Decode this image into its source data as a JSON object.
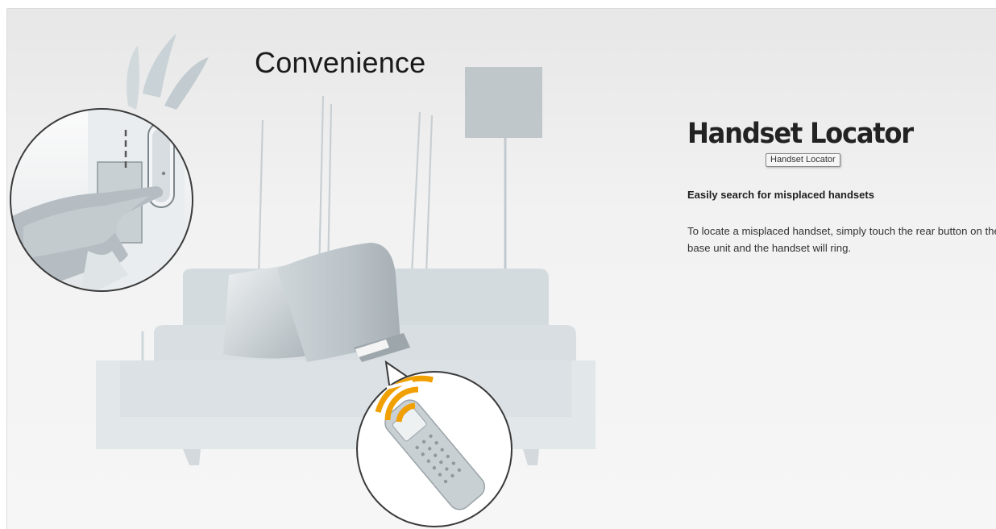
{
  "illustration": {
    "heading": "Convenience",
    "accent_color": "#f0a000"
  },
  "feature": {
    "title": "Handset Locator",
    "tooltip": "Handset Locator",
    "subtitle": "Easily search for misplaced handsets",
    "description": "To locate a misplaced handset, simply touch the rear button on the base unit and the handset will ring."
  }
}
